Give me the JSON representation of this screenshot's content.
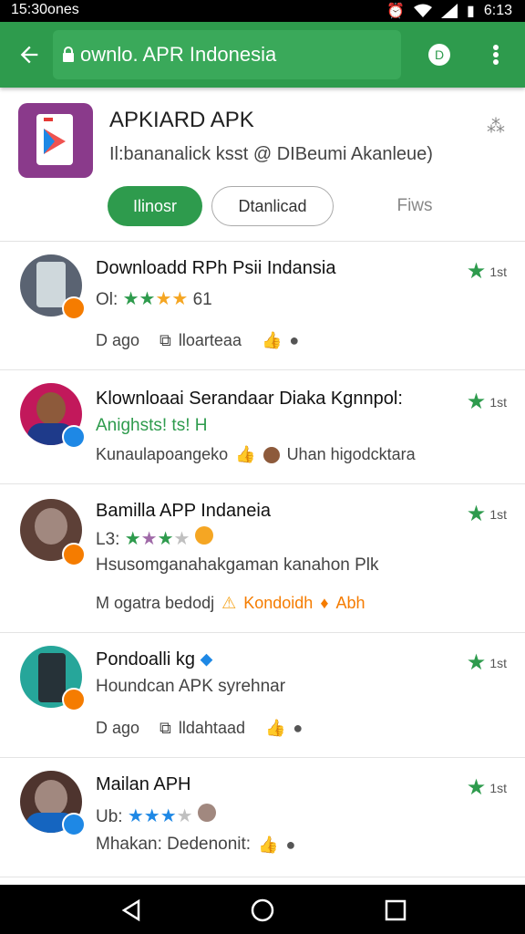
{
  "status": {
    "time": "15:30ones",
    "battery_time": "6:13"
  },
  "browser": {
    "url": "ownlo. APR Indonesia"
  },
  "app": {
    "title": "APKIARD APK",
    "subtitle": "Il:bananalick ksst @ DIBeumi Akanleue)",
    "primary_button": "Ilinosr",
    "outline_button": "Dtanlicad",
    "text_button": "Fiws"
  },
  "items": [
    {
      "title": "Downloadd RPh Psii Indansia",
      "line": "Ol:",
      "rating_text": "61",
      "meta1": "D ago",
      "meta2": "lloarteaa",
      "rate": "1st"
    },
    {
      "title": "Klownloaai Serandaar Diaka Kgnnpol:",
      "line": "Anighsts! ts! H",
      "meta1": "Kunaulapoangeko",
      "meta2": "Uhan higodcktara",
      "rate": "1st"
    },
    {
      "title": "Bamilla APP Indaneia",
      "line": "L3:",
      "line2": "Hsusomganahakgaman kanahon Plk",
      "meta1": "M ogatra bedodj",
      "meta2": "Kondoidh",
      "meta3": "Abh",
      "rate": "1st"
    },
    {
      "title": "Pondoalli kg",
      "line": "Houndcan APK syrehnar",
      "meta1": "D ago",
      "meta2": "lldahtaad",
      "rate": "1st"
    },
    {
      "title": "Mailan APH",
      "line": "Ub:",
      "line2": "Mhakan: Dedenonit:",
      "rate": "1st"
    }
  ]
}
